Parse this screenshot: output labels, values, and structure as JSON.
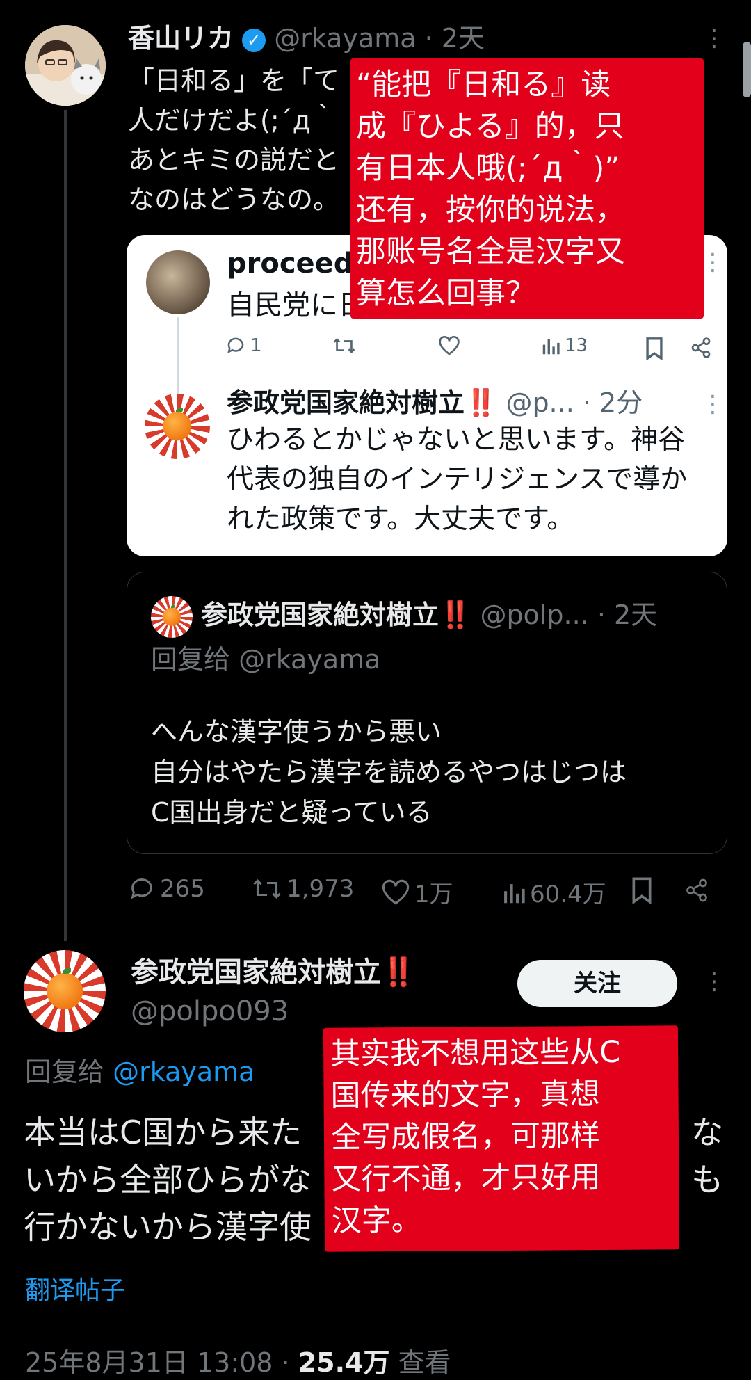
{
  "main_post": {
    "author_name": "香山リカ",
    "handle": "@rkayama",
    "time": "· 2天",
    "text_lines": [
      "「日和る」を「て",
      "人だけだよ(;´д｀",
      "あとキミの説だと",
      "なのはどうなの。"
    ]
  },
  "embedded_card": {
    "first_author": "proceed",
    "first_text": "自民党に日",
    "first_stats": {
      "replies": "1",
      "views": "13"
    },
    "second_author": "参政党国家絶対樹立",
    "second_bangs": "‼️",
    "second_handle": "@p...",
    "second_time": "· 2分",
    "second_text_lines": [
      "ひわるとかじゃないと思います。神谷",
      "代表の独自のインテリジェンスで導か",
      "れた政策です。大丈夫です。"
    ]
  },
  "quote_card": {
    "author_name": "参政党国家絶対樹立",
    "bangs": "‼️",
    "handle": "@polp...",
    "time": "· 2天",
    "reply_to": "回复给 @rkayama",
    "text_lines": [
      "へんな漢字使うから悪い",
      "自分はやたら漢字を読めるやつはじつは",
      "C国出身だと疑っている"
    ]
  },
  "main_stats": {
    "replies": "265",
    "retweets": "1,973",
    "likes": "1万",
    "views": "60.4万"
  },
  "reply_post": {
    "author_name": "参政党国家絶対樹立",
    "bangs": "‼️",
    "handle": "@polpo093",
    "follow_label": "关注",
    "reply_to_prefix": "回复给",
    "reply_to_handle": "@rkayama",
    "text_lines": [
      "本当はC国から来た",
      "いから全部ひらがな",
      "行かないから漢字使"
    ],
    "text_right_fragments": [
      "な",
      "も"
    ],
    "translate_label": "翻译帖子",
    "timestamp_prefix": "25年8月31日 13:08 · ",
    "views_count": "25.4万",
    "views_label": "查看"
  },
  "annotations": {
    "box1_lines": [
      "“能把『日和る』读",
      "成『ひよる』的，只",
      "有日本人哦(;´д｀)”",
      "还有，按你的说法，",
      "那账号名全是汉字又",
      "算怎么回事？"
    ],
    "box2_lines": [
      "其实我不想用这些从C",
      "国传来的文字，真想",
      "全写成假名，可那样",
      "又行不通，才只好用",
      "汉字。"
    ]
  },
  "colors": {
    "background": "#000000",
    "link": "#1d9bf0",
    "annotation_red": "#e3001b",
    "muted": "#71767b"
  }
}
